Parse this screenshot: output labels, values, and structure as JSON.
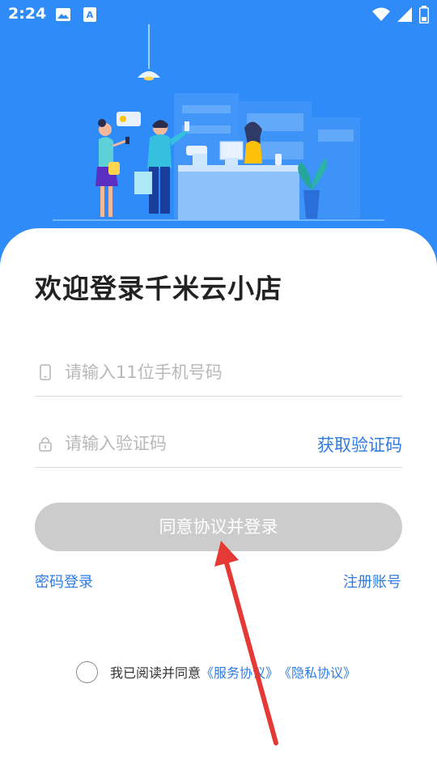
{
  "status_bar": {
    "time": "2:24",
    "icons": [
      "image-icon",
      "keyboard-a-icon",
      "wifi-icon",
      "signal-icon",
      "battery-icon"
    ]
  },
  "colors": {
    "hero_blue": "#2e8bf7",
    "link_blue": "#2c7be5",
    "disabled_button": "#cccccc",
    "annotation_red": "#e53935"
  },
  "login": {
    "welcome_title": "欢迎登录千米云小店",
    "phone_placeholder": "请输入11位手机号码",
    "code_placeholder": "请输入验证码",
    "get_code_label": "获取验证码",
    "submit_label": "同意协议并登录",
    "password_login_label": "密码登录",
    "register_label": "注册账号"
  },
  "agreement": {
    "prefix": "我已阅读并同意",
    "service_link": "《服务协议》",
    "privacy_link": "《隐私协议》"
  }
}
